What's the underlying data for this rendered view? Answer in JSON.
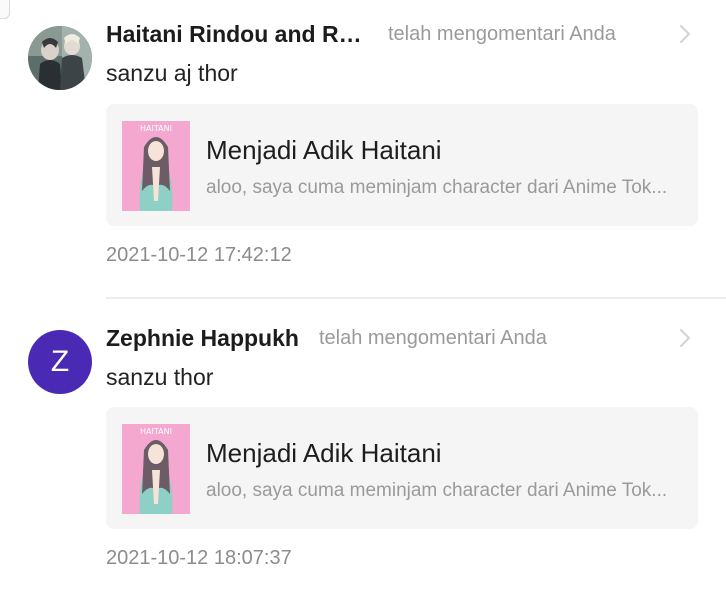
{
  "notifications": [
    {
      "user_name": "Haitani Rindou and Ra...",
      "action": "telah mengomentari Anda",
      "comment": "sanzu aj thor",
      "story": {
        "title": "Menjadi Adik Haitani",
        "excerpt": "aloo, saya cuma meminjam character dari Anime Tok...",
        "cover_text": "HAITANI"
      },
      "timestamp": "2021-10-12 17:42:12"
    },
    {
      "user_name": "Zephnie Happukh",
      "avatar_letter": "Z",
      "action": "telah mengomentari Anda",
      "comment": "sanzu thor",
      "story": {
        "title": "Menjadi Adik Haitani",
        "excerpt": "aloo, saya cuma meminjam character dari Anime Tok...",
        "cover_text": "HAITANI"
      },
      "timestamp": "2021-10-12 18:07:37"
    }
  ],
  "colors": {
    "avatar_purple": "#4a2ab5",
    "card_background": "#f5f5f5",
    "muted_text": "#9a9a9a"
  },
  "icons": {
    "chevron": "chevron-right-icon"
  }
}
